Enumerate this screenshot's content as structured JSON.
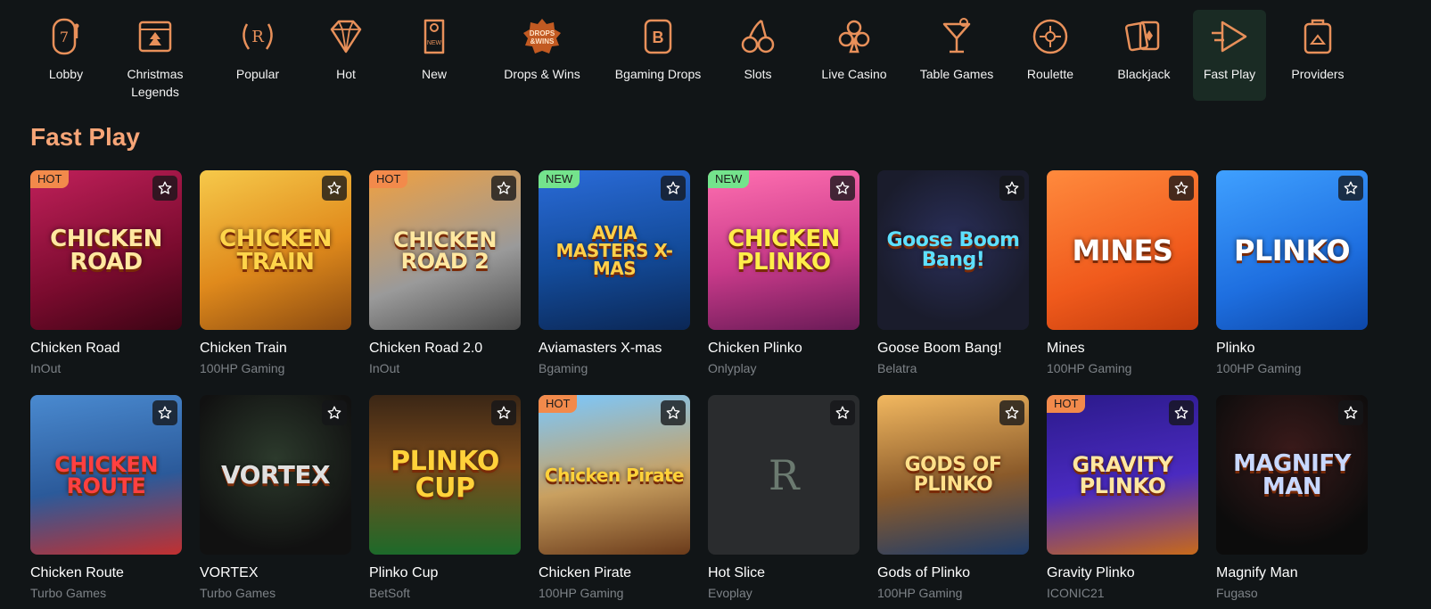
{
  "nav": {
    "items": [
      {
        "label": "Lobby",
        "icon": "slot-machine-seven-icon"
      },
      {
        "label": "Christmas\nLegends",
        "icon": "christmas-calendar-icon"
      },
      {
        "label": "Popular",
        "icon": "laurel-r-icon"
      },
      {
        "label": "Hot",
        "icon": "diamond-icon"
      },
      {
        "label": "New",
        "icon": "door-hanger-new-icon"
      },
      {
        "label": "Drops & Wins",
        "icon": "drops-and-wins-badge-icon"
      },
      {
        "label": "Bgaming Drops",
        "icon": "bgaming-b-icon"
      },
      {
        "label": "Slots",
        "icon": "cherries-icon"
      },
      {
        "label": "Live Casino",
        "icon": "club-suit-icon"
      },
      {
        "label": "Table Games",
        "icon": "cocktail-glass-icon"
      },
      {
        "label": "Roulette",
        "icon": "roulette-wheel-icon"
      },
      {
        "label": "Blackjack",
        "icon": "playing-cards-icon"
      },
      {
        "label": "Fast Play",
        "icon": "fast-play-arrow-icon",
        "active": true
      },
      {
        "label": "Providers",
        "icon": "providers-bag-icon"
      }
    ]
  },
  "section": {
    "title": "Fast Play"
  },
  "games": [
    {
      "title": "Chicken Road",
      "provider": "InOut",
      "badge": "HOT",
      "art_text": "CHICKEN ROAD"
    },
    {
      "title": "Chicken Train",
      "provider": "100HP Gaming",
      "badge": "",
      "art_text": "CHICKEN TRAIN"
    },
    {
      "title": "Chicken Road 2.0",
      "provider": "InOut",
      "badge": "HOT",
      "art_text": "CHICKEN ROAD 2"
    },
    {
      "title": "Aviamasters X-mas",
      "provider": "Bgaming",
      "badge": "NEW",
      "art_text": "AVIA MASTERS X-MAS"
    },
    {
      "title": "Chicken Plinko",
      "provider": "Onlyplay",
      "badge": "NEW",
      "art_text": "CHICKEN PLINKO"
    },
    {
      "title": "Goose Boom Bang!",
      "provider": "Belatra",
      "badge": "",
      "art_text": "Goose Boom Bang!"
    },
    {
      "title": "Mines",
      "provider": "100HP Gaming",
      "badge": "",
      "art_text": "MINES"
    },
    {
      "title": "Plinko",
      "provider": "100HP Gaming",
      "badge": "",
      "art_text": "PLINKO"
    },
    {
      "title": "Chicken Route",
      "provider": "Turbo Games",
      "badge": "",
      "art_text": "CHICKEN ROUTE"
    },
    {
      "title": "VORTEX",
      "provider": "Turbo Games",
      "badge": "",
      "art_text": "VORTEX"
    },
    {
      "title": "Plinko Cup",
      "provider": "BetSoft",
      "badge": "",
      "art_text": "PLINKO CUP"
    },
    {
      "title": "Chicken Pirate",
      "provider": "100HP Gaming",
      "badge": "HOT",
      "art_text": "Chicken Pirate"
    },
    {
      "title": "Hot Slice",
      "provider": "Evoplay",
      "badge": "",
      "art_text": "R"
    },
    {
      "title": "Gods of Plinko",
      "provider": "100HP Gaming",
      "badge": "",
      "art_text": "GODS OF PLINKO"
    },
    {
      "title": "Gravity Plinko",
      "provider": "ICONIC21",
      "badge": "HOT",
      "art_text": "GRAVITY PLINKO"
    },
    {
      "title": "Magnify Man",
      "provider": "Fugaso",
      "badge": "",
      "art_text": "MAGNIFY MAN"
    }
  ],
  "colors": {
    "background": "#111517",
    "accent": "#f7a577",
    "hot_badge": "#f28a4b",
    "new_badge": "#74e38c",
    "active_nav": "#1a2b24"
  }
}
